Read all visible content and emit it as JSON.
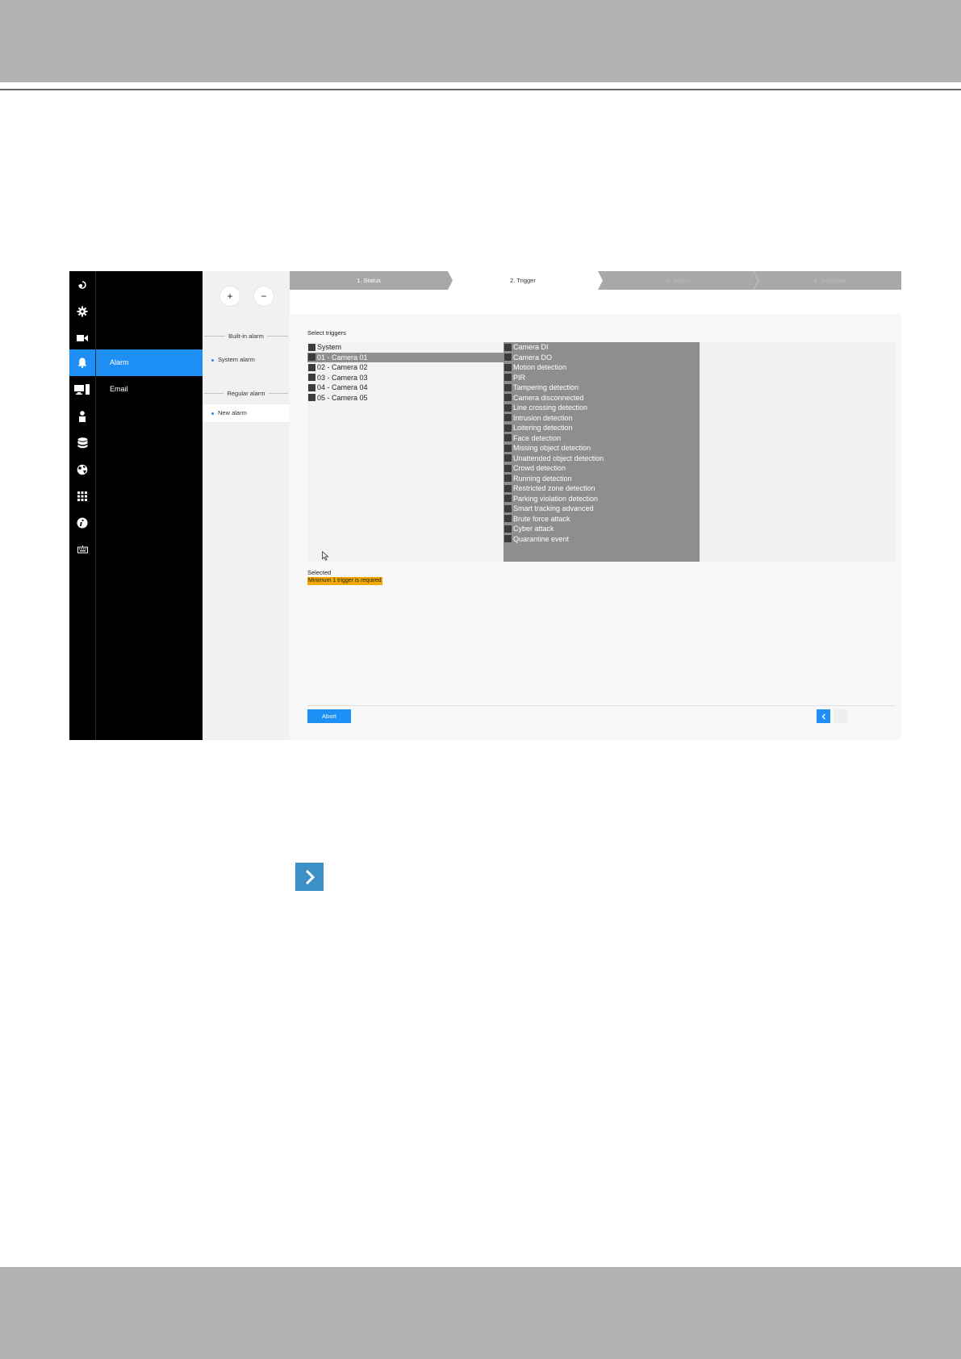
{
  "rail_icons": [
    "logo-icon",
    "gear-icon",
    "video-camera-icon",
    "bell-icon",
    "monitor-icon",
    "user-icon",
    "database-icon",
    "globe-icon",
    "grid-icon",
    "info-icon",
    "keyboard-icon"
  ],
  "menu": {
    "items": [
      {
        "label": "Alarm"
      },
      {
        "label": "Email"
      }
    ]
  },
  "alarm_list": {
    "add": "+",
    "remove": "−",
    "builtin_title": "Built-in alarm",
    "builtin_items": [
      "System alarm"
    ],
    "regular_title": "Regular alarm",
    "regular_items": [
      "New alarm"
    ]
  },
  "wizard": {
    "steps": [
      "1. Status",
      "2. Trigger",
      "3. Action",
      "4. Schedule"
    ],
    "active_index": 1
  },
  "triggers": {
    "select_label": "Select triggers",
    "sources": [
      "System",
      "01 - Camera 01",
      "02 - Camera 02",
      "03 - Camera 03",
      "04 - Camera 04",
      "05 - Camera 05"
    ],
    "highlighted_source": 1,
    "events": [
      "Camera DI",
      "Camera DO",
      "Motion detection",
      "PIR",
      "Tampering detection",
      "Camera disconnected",
      "Line crossing detection",
      "Intrusion detection",
      "Loitering detection",
      "Face detection",
      "Missing object detection",
      "Unattended object detection",
      "Crowd detection",
      "Running detection",
      "Restricted zone detection",
      "Parking violation detection",
      "Smart tracking advanced",
      "Brute force attack",
      "Cyber attack",
      "Quarantine event"
    ],
    "selected_label": "Selected",
    "warning": "Minimum 1 trigger is required"
  },
  "footer": {
    "abort": "Abort",
    "prev_icon": "chevron-left-icon"
  },
  "next_icon": "chevron-right-icon",
  "colors": {
    "accent": "#1e8ff4",
    "warning": "#f1a900",
    "list_highlight": "#8e8e8e"
  }
}
